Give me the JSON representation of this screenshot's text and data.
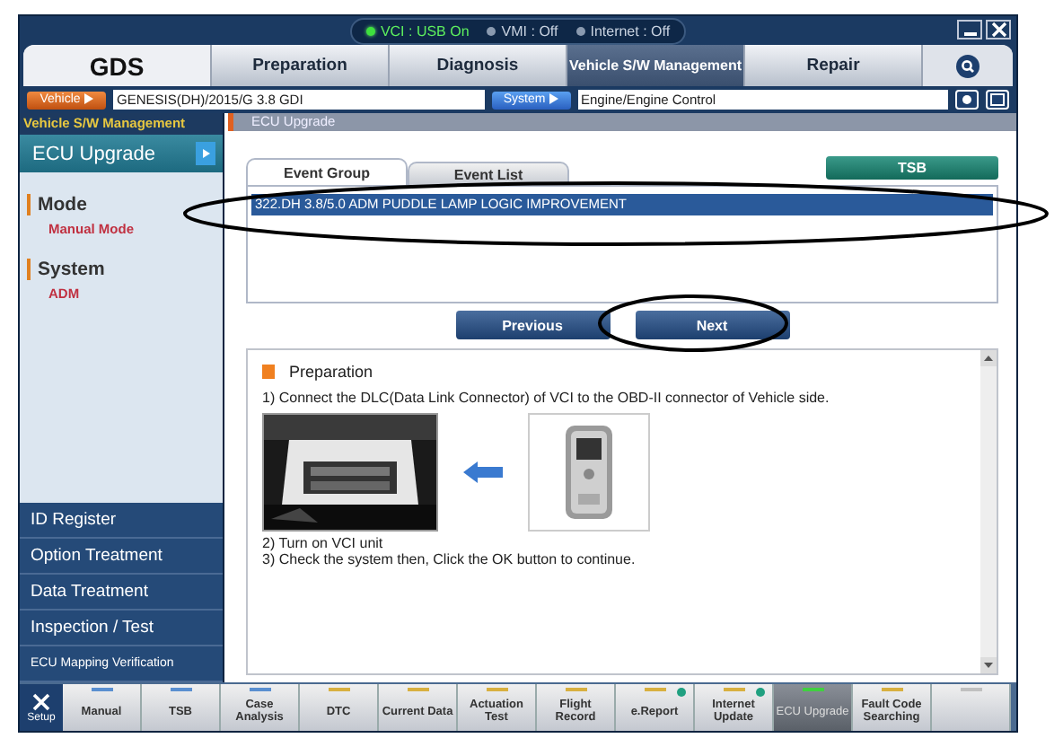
{
  "status": [
    {
      "label": "VCI : USB On",
      "on": true
    },
    {
      "label": "VMI : Off",
      "on": false
    },
    {
      "label": "Internet : Off",
      "on": false
    }
  ],
  "logo": "GDS",
  "nav_tabs": [
    {
      "label": "Preparation",
      "selected": false
    },
    {
      "label": "Diagnosis",
      "selected": false
    },
    {
      "label": "Vehicle S/W Management",
      "selected": true
    },
    {
      "label": "Repair",
      "selected": false
    }
  ],
  "vehicle": {
    "button": "Vehicle",
    "value": "GENESIS(DH)/2015/G 3.8 GDI"
  },
  "system": {
    "button": "System",
    "value": "Engine/Engine Control"
  },
  "sidebar": {
    "header": "Vehicle S/W Management",
    "current": "ECU Upgrade",
    "sections": [
      {
        "title": "Mode",
        "value": "Manual Mode"
      },
      {
        "title": "System",
        "value": "ADM"
      }
    ],
    "items": [
      "ID Register",
      "Option Treatment",
      "Data Treatment",
      "Inspection / Test",
      "ECU Mapping Verification"
    ]
  },
  "content": {
    "header": "ECU Upgrade",
    "tabs": [
      {
        "label": "Event Group",
        "selected": true
      },
      {
        "label": "Event List",
        "selected": false
      }
    ],
    "tsb_button": "TSB",
    "events": [
      {
        "label": "322.DH 3.8/5.0 ADM PUDDLE LAMP LOGIC IMPROVEMENT",
        "selected": true
      }
    ],
    "buttons": [
      "Previous",
      "Next"
    ],
    "instructions": {
      "title": "Preparation",
      "steps": [
        "1) Connect the DLC(Data Link Connector) of VCI to the OBD-II connector of Vehicle side.",
        "2) Turn on VCI unit",
        "3) Check the system then, Click the OK button to continue."
      ]
    }
  },
  "toolbar": [
    {
      "kind": "setup",
      "label": "Setup"
    },
    {
      "kind": "tool",
      "label": "Manual",
      "color": "#5a8fd0",
      "selected": false,
      "info": false
    },
    {
      "kind": "tool",
      "label": "TSB",
      "color": "#5a8fd0",
      "selected": false,
      "info": false
    },
    {
      "kind": "tool",
      "label": "Case Analysis",
      "color": "#5a8fd0",
      "selected": false,
      "info": false
    },
    {
      "kind": "tool",
      "label": "DTC",
      "color": "#d8b040",
      "selected": false,
      "info": false
    },
    {
      "kind": "tool",
      "label": "Current Data",
      "color": "#d8b040",
      "selected": false,
      "info": false
    },
    {
      "kind": "tool",
      "label": "Actuation Test",
      "color": "#d8b040",
      "selected": false,
      "info": false
    },
    {
      "kind": "tool",
      "label": "Flight Record",
      "color": "#d8b040",
      "selected": false,
      "info": false
    },
    {
      "kind": "tool",
      "label": "e.Report",
      "color": "#d8b040",
      "selected": false,
      "info": true
    },
    {
      "kind": "tool",
      "label": "Internet Update",
      "color": "#d8b040",
      "selected": false,
      "info": true
    },
    {
      "kind": "tool",
      "label": "ECU Upgrade",
      "color": "#40d040",
      "selected": true,
      "info": false
    },
    {
      "kind": "tool",
      "label": "Fault Code Searching",
      "color": "#d8b040",
      "selected": false,
      "info": false
    },
    {
      "kind": "tool",
      "color": "#c0c0c0",
      "selected": false,
      "info": false
    }
  ]
}
